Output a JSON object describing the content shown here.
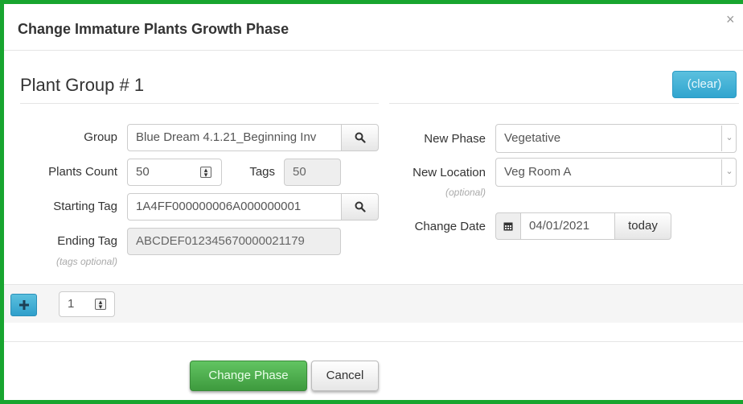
{
  "dialog": {
    "title": "Change Immature Plants Growth Phase",
    "close_glyph": "×"
  },
  "group": {
    "title": "Plant Group # 1",
    "clear_label": "(clear)"
  },
  "left": {
    "group_label": "Group",
    "group_value": "Blue Dream 4.1.21_Beginning Inv",
    "plants_count_label": "Plants Count",
    "plants_count_value": "50",
    "tags_label": "Tags",
    "tags_value": "50",
    "starting_tag_label": "Starting Tag",
    "starting_tag_value": "1A4FF000000006A000000001",
    "ending_tag_label": "Ending Tag",
    "ending_tag_value": "ABCDEF012345670000021179",
    "ending_tag_note": "(tags optional)"
  },
  "right": {
    "new_phase_label": "New Phase",
    "new_phase_value": "Vegetative",
    "new_location_label": "New Location",
    "new_location_value": "Veg Room A",
    "new_location_note": "(optional)",
    "change_date_label": "Change Date",
    "change_date_value": "04/01/2021",
    "today_label": "today"
  },
  "add_row": {
    "count_value": "1"
  },
  "footer": {
    "change_phase_label": "Change Phase",
    "cancel_label": "Cancel"
  },
  "icons": {
    "search": "search-icon",
    "calendar": "calendar-icon",
    "plus": "plus-icon",
    "spinner": "spinner-icon",
    "caret": "chevron-down-icon"
  },
  "colors": {
    "frame_border": "#18a52f",
    "info_button": "#5bc0de",
    "success_button": "#4cae4c"
  }
}
